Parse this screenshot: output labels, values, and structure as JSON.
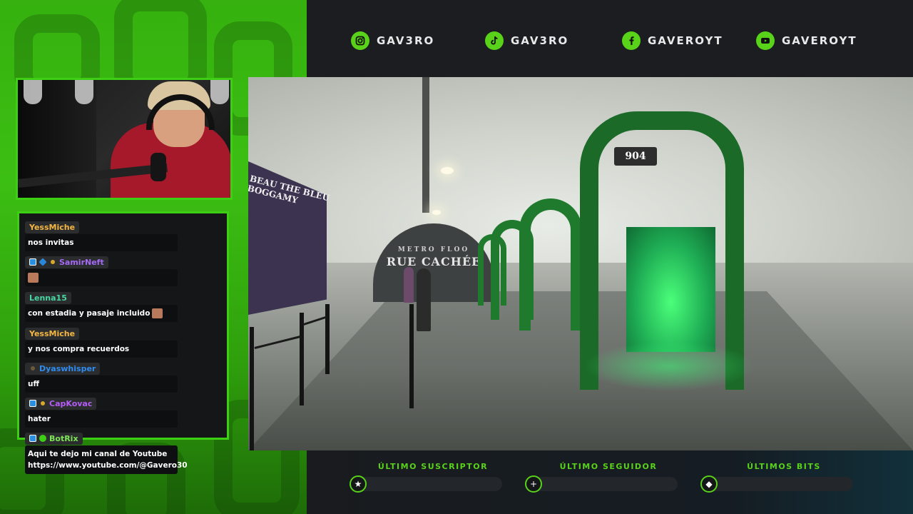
{
  "social": [
    {
      "icon": "instagram-icon",
      "handle": "GAV3RO"
    },
    {
      "icon": "tiktok-icon",
      "handle": "GAV3RO"
    },
    {
      "icon": "facebook-icon",
      "handle": "GAVEROYT"
    },
    {
      "icon": "youtube-icon",
      "handle": "GAVEROYT"
    }
  ],
  "chat": [
    {
      "user": "YessMiche",
      "color": "#f5b642",
      "badges": [],
      "text": "nos invitas"
    },
    {
      "user": "SamirNeft",
      "color": "#a56af5",
      "badges": [
        "blue",
        "cube",
        "gold"
      ],
      "text": "",
      "emote": true
    },
    {
      "user": "Lenna15",
      "color": "#48d7a2",
      "badges": [],
      "text": "con estadia y pasaje incluido",
      "emote": true
    },
    {
      "user": "YessMiche",
      "color": "#f5b642",
      "badges": [],
      "text": "y nos compra recuerdos"
    },
    {
      "user": "Dyaswhisper",
      "color": "#2f8cf0",
      "badges": [
        "tiny-dark"
      ],
      "text": "uff"
    },
    {
      "user": "CapKovac",
      "color": "#b45cf5",
      "badges": [
        "blue",
        "gold"
      ],
      "text": "hater"
    },
    {
      "user": "BotRix",
      "color": "#7fe35a",
      "badges": [
        "blue",
        "green"
      ],
      "text": "Aqui te dejo mi canal de Youtube https://www.youtube.com/@Gavero30"
    }
  ],
  "video": {
    "sign_number": "904",
    "end_wall_small": "METRO FLOO",
    "end_wall_text": "RUE CACHÉE",
    "poster_line1": "BEAU THE BLEU",
    "poster_line2": "BOGGAMY"
  },
  "stats": [
    {
      "label": "ÚLTIMO SUSCRIPTOR",
      "icon": "star-icon",
      "glyph": "★",
      "value": ""
    },
    {
      "label": "ÚLTIMO SEGUIDOR",
      "icon": "plus-icon",
      "glyph": "+",
      "value": ""
    },
    {
      "label": "ÚLTIMOS BITS",
      "icon": "bits-icon",
      "glyph": "◆",
      "value": ""
    }
  ],
  "colors": {
    "accent": "#59d21a",
    "panel_green": "#3cbf13",
    "bar_dark": "#1b1d20"
  }
}
